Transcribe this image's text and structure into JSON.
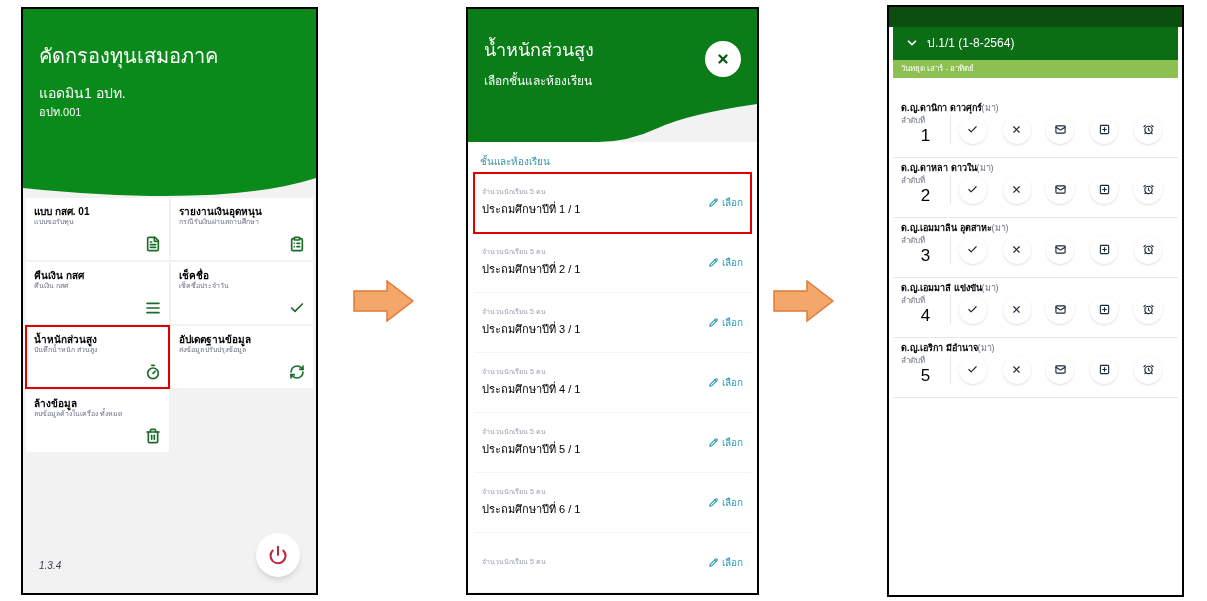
{
  "menu_screen": {
    "title": "คัดกรองทุนเสมอภาค",
    "user_name": "แอดมิน1 อปท.",
    "user_code": "อปท.001",
    "tiles": [
      {
        "title": "แบบ กสศ. 01",
        "subtitle": "แบบขอรับทุน",
        "highlighted": false
      },
      {
        "title": "รายงานเงินอุดหนุน",
        "subtitle": "กรณี รับเงินผ่านสถานศึกษา",
        "highlighted": false
      },
      {
        "title": "คืนเงิน กสศ",
        "subtitle": "คืนเงิน กสศ",
        "highlighted": false
      },
      {
        "title": "เช็คชื่อ",
        "subtitle": "เช็คชื่อประจำวัน",
        "highlighted": false
      },
      {
        "title": "น้ำหนักส่วนสูง",
        "subtitle": "บันทึกน้ำหนัก ส่วนสูง",
        "highlighted": true
      },
      {
        "title": "อัปเดตฐานข้อมูล",
        "subtitle": "ส่งข้อมูล ปรับปรุงข้อมูล",
        "highlighted": false
      },
      {
        "title": "ล้างข้อมูล",
        "subtitle": "ลบข้อมูลค้างในเครื่อง ทั้งหมด",
        "highlighted": false
      }
    ],
    "version": "1.3.4"
  },
  "class_screen": {
    "title": "น้ำหนักส่วนสูง",
    "subtitle": "เลือกชั้นและห้องเรียน",
    "section": "ชั้นและห้องเรียน",
    "rows": [
      {
        "count": "จำนวนนักเรียน 5 คน",
        "name": "ประถมศึกษาปีที่ 1 / 1",
        "action": "เลือก",
        "highlighted": true
      },
      {
        "count": "จำนวนนักเรียน 5 คน",
        "name": "ประถมศึกษาปีที่ 2 / 1",
        "action": "เลือก",
        "highlighted": false
      },
      {
        "count": "จำนวนนักเรียน 5 คน",
        "name": "ประถมศึกษาปีที่ 3 / 1",
        "action": "เลือก",
        "highlighted": false
      },
      {
        "count": "จำนวนนักเรียน 5 คน",
        "name": "ประถมศึกษาปีที่ 4 / 1",
        "action": "เลือก",
        "highlighted": false
      },
      {
        "count": "จำนวนนักเรียน 5 คน",
        "name": "ประถมศึกษาปีที่ 5 / 1",
        "action": "เลือก",
        "highlighted": false
      },
      {
        "count": "จำนวนนักเรียน 5 คน",
        "name": "ประถมศึกษาปีที่ 6 / 1",
        "action": "เลือก",
        "highlighted": false
      },
      {
        "count": "จำนวนนักเรียน 5 คน",
        "action": "เลือก",
        "highlighted": false
      }
    ]
  },
  "attendance_screen": {
    "class_header": "ป.1/1 (1-8-2564)",
    "notice": "วันหยุด เสาร์ - อาทิตย์",
    "students": [
      {
        "name": "ด.ญ.ดานิกา ดาวศุกร์",
        "status": "(มา)",
        "number_label": "ลำดับที่",
        "number": "1"
      },
      {
        "name": "ด.ญ.ดาหลา ดาวใน",
        "status": "(มา)",
        "number_label": "ลำดับที่",
        "number": "2"
      },
      {
        "name": "ด.ญ.เอมมาลิน อุตสาหะ",
        "status": "(มา)",
        "number_label": "ลำดับที่",
        "number": "3"
      },
      {
        "name": "ด.ญ.เอมมาลี แข่งขัน",
        "status": "(มา)",
        "number_label": "ลำดับที่",
        "number": "4"
      },
      {
        "name": "ด.ญ.เอริกา มีอำนาจ",
        "status": "(มา)",
        "number_label": "ลำดับที่",
        "number": "5"
      }
    ]
  }
}
